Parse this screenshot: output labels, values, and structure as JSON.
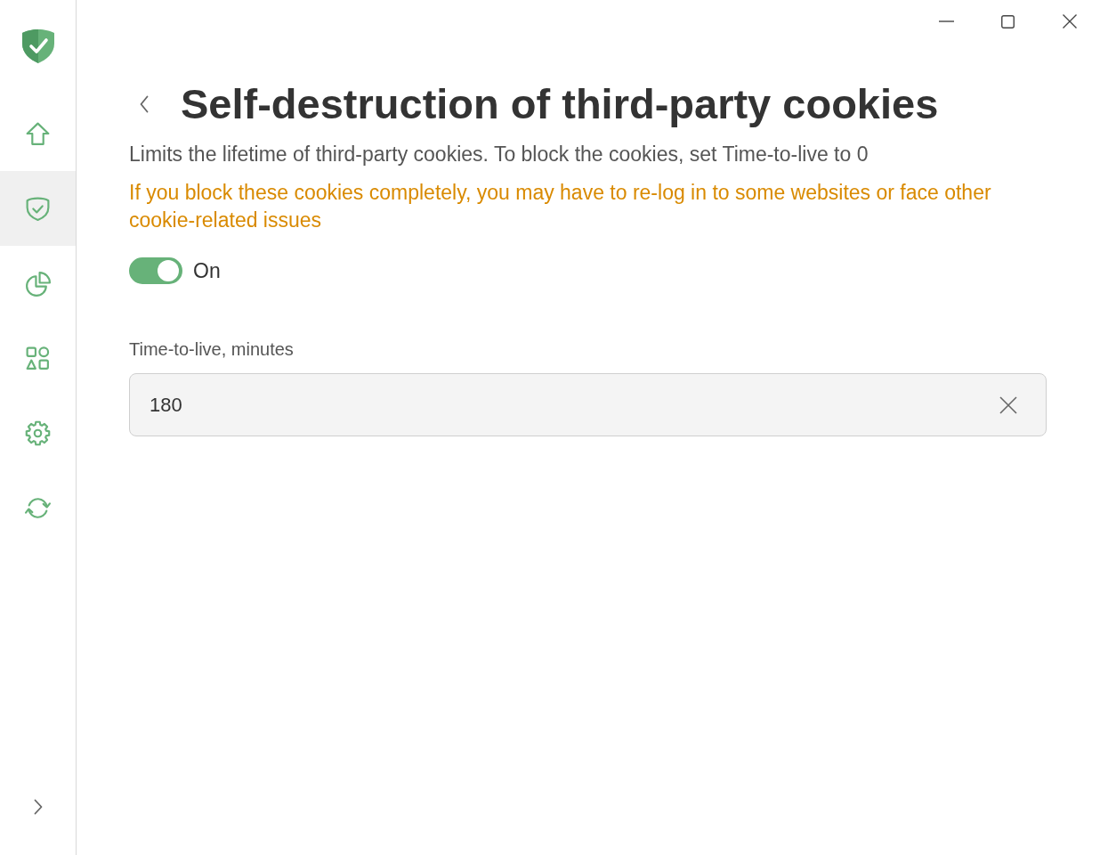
{
  "sidebar": {
    "items": [
      {
        "selected": false
      },
      {
        "selected": true
      },
      {
        "selected": false
      },
      {
        "selected": false
      },
      {
        "selected": false
      },
      {
        "selected": false
      }
    ]
  },
  "page": {
    "title": "Self-destruction of third-party cookies",
    "description": "Limits the lifetime of third-party cookies. To block the cookies, set Time-to-live to 0",
    "warning": "If you block these cookies completely, you may have to re-log in to some websites or face other cookie-related issues",
    "toggle": {
      "on": true,
      "label": "On"
    },
    "ttl_field": {
      "label": "Time-to-live, minutes",
      "value": "180"
    }
  }
}
